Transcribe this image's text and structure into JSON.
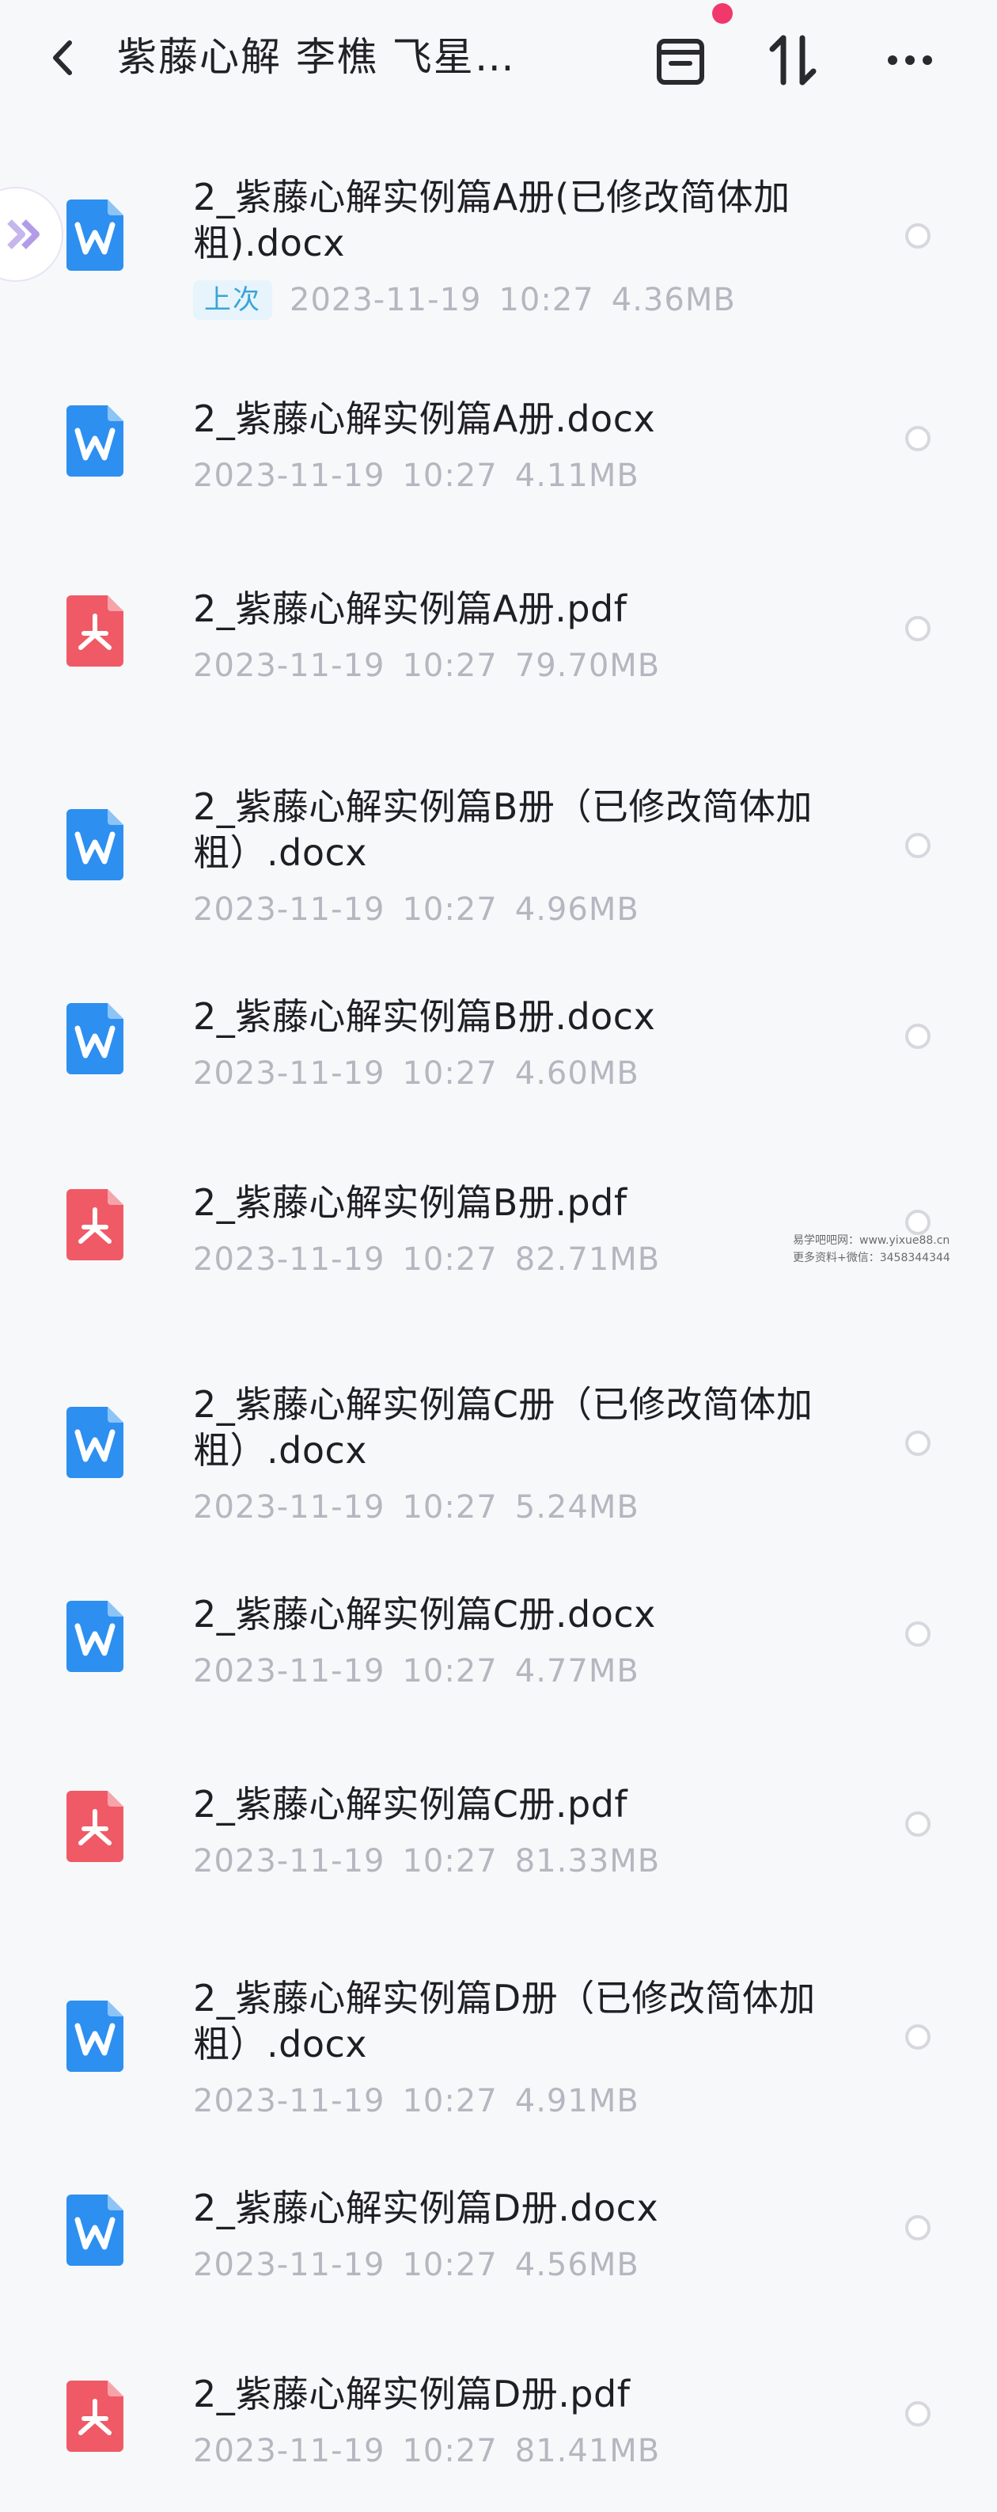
{
  "header": {
    "title": "紫藤心解 李樵 飞星…",
    "back_icon": "chevron-left-icon",
    "archive_icon": "archive-box-icon",
    "sort_icon": "sort-arrows-icon",
    "more_icon": "more-dots-icon",
    "notification_dot_color": "#f0386b"
  },
  "side_handle": {
    "icon": "double-chevron-icon"
  },
  "files": [
    {
      "type": "docx",
      "name": "2_紫藤心解实例篇A册(已修改简体加粗).docx",
      "tag": "上次",
      "date": "2023-11-19",
      "time": "10:27",
      "size": "4.36MB"
    },
    {
      "type": "docx",
      "name": "2_紫藤心解实例篇A册.docx",
      "date": "2023-11-19",
      "time": "10:27",
      "size": "4.11MB"
    },
    {
      "type": "pdf",
      "name": "2_紫藤心解实例篇A册.pdf",
      "date": "2023-11-19",
      "time": "10:27",
      "size": "79.70MB"
    },
    {
      "type": "docx",
      "name": "2_紫藤心解实例篇B册（已修改简体加粗）.docx",
      "date": "2023-11-19",
      "time": "10:27",
      "size": "4.96MB"
    },
    {
      "type": "docx",
      "name": "2_紫藤心解实例篇B册.docx",
      "date": "2023-11-19",
      "time": "10:27",
      "size": "4.60MB"
    },
    {
      "type": "pdf",
      "name": "2_紫藤心解实例篇B册.pdf",
      "date": "2023-11-19",
      "time": "10:27",
      "size": "82.71MB"
    },
    {
      "type": "docx",
      "name": "2_紫藤心解实例篇C册（已修改简体加粗）.docx",
      "date": "2023-11-19",
      "time": "10:27",
      "size": "5.24MB"
    },
    {
      "type": "docx",
      "name": "2_紫藤心解实例篇C册.docx",
      "date": "2023-11-19",
      "time": "10:27",
      "size": "4.77MB"
    },
    {
      "type": "pdf",
      "name": "2_紫藤心解实例篇C册.pdf",
      "date": "2023-11-19",
      "time": "10:27",
      "size": "81.33MB"
    },
    {
      "type": "docx",
      "name": "2_紫藤心解实例篇D册（已修改简体加粗）.docx",
      "date": "2023-11-19",
      "time": "10:27",
      "size": "4.91MB"
    },
    {
      "type": "docx",
      "name": "2_紫藤心解实例篇D册.docx",
      "date": "2023-11-19",
      "time": "10:27",
      "size": "4.56MB"
    },
    {
      "type": "pdf",
      "name": "2_紫藤心解实例篇D册.pdf",
      "date": "2023-11-19",
      "time": "10:27",
      "size": "81.41MB"
    }
  ],
  "colors": {
    "docx_icon": "#2d8ff0",
    "pdf_icon": "#ef5a66",
    "tag_bg": "#e7f4fb",
    "tag_text": "#3aa5d8"
  },
  "watermark": {
    "line1": "易学吧吧网：www.yixue88.cn",
    "line2": "更多资料+微信：3458344344"
  }
}
